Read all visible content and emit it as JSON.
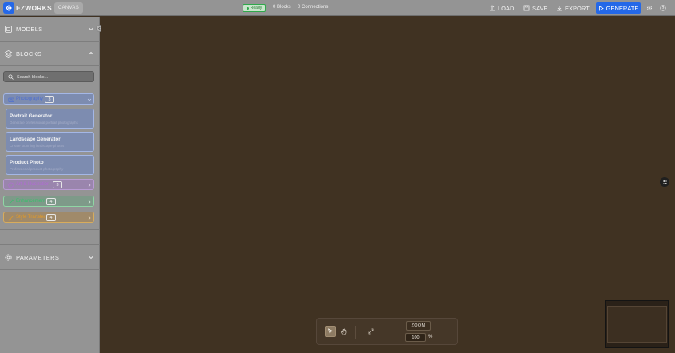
{
  "app": {
    "name": "EZWORKS",
    "canvas_tab": "CANVAS"
  },
  "header": {
    "status": "Ready",
    "blocks_count": "0 Blocks",
    "connections_count": "0 Connections",
    "load_label": "LOAD",
    "save_label": "SAVE",
    "export_label": "EXPORT",
    "generate_label": "GENERATE"
  },
  "sidebar": {
    "models_title": "MODELS",
    "blocks_title": "BLOCKS",
    "parameters_title": "PARAMETERS",
    "search_placeholder": "Search blocks...",
    "categories": [
      {
        "label": "Photography",
        "count": "3",
        "expanded": true,
        "color": "#4e6fd0"
      },
      {
        "label": "Art & Illustration",
        "count": "3",
        "expanded": false,
        "color": "#b26ad6"
      },
      {
        "label": "Enhancement",
        "count": "4",
        "expanded": false,
        "color": "#36c06a"
      },
      {
        "label": "Style Transfer",
        "count": "4",
        "expanded": false,
        "color": "#e39a26"
      }
    ],
    "photography_blocks": [
      {
        "title": "Portrait Generator",
        "desc": "Generate professional portrait photographs"
      },
      {
        "title": "Landscape Generator",
        "desc": "Create stunning landscape photos"
      },
      {
        "title": "Product Photo",
        "desc": "Professional product photography"
      }
    ]
  },
  "canvas_toolbar": {
    "zoom_label": "ZOOM",
    "zoom_value": "100",
    "zoom_unit": "%"
  },
  "colors": {
    "accent": "#2468e8",
    "canvas_bg": "#403222",
    "panel_bg": "#949494"
  }
}
